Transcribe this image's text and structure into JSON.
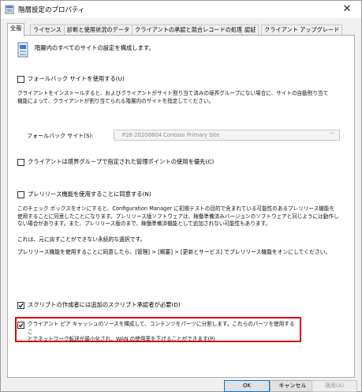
{
  "window": {
    "title": "階層設定のプロパティ",
    "close_glyph": "✕"
  },
  "tabs": [
    {
      "label": "全般",
      "active": true
    },
    {
      "label": "ライセンス"
    },
    {
      "label": "診断と使用状況のデータ"
    },
    {
      "label": "クライアントの承認と競合レコードの処理"
    },
    {
      "label": "認証"
    },
    {
      "label": "クライアント アップグレード"
    }
  ],
  "general": {
    "header_text": "階層内のすべてのサイトの設定を構成します。",
    "fallback": {
      "label": "フォールバック サイトを使用する(U)",
      "checked": false,
      "desc_line1": "クライアントをインストールすると、およびクライアントがサイト割り当て済みの境界グループにない場合に、サイトの自動割り当て",
      "desc_line2": "機能によって、クライアントが割り当てられる階層内のサイトを指定してください。",
      "site_label": "フォールバック サイト(S):",
      "site_value": "P26-20200604 Contoso Primary Site"
    },
    "prefer_mp": {
      "label": "クライアントは境界グループで指定された管理ポイントの使用を優先(C)",
      "checked": false
    },
    "prerelease": {
      "label": "プレリリース機能を使用することに同意する(N)",
      "checked": false,
      "desc_lines": [
        "このチェック ボックスをオンにすると、Configuration Manager に初期テストの目的で含まれている可能性のあるプレリリース機能を",
        "使用することに同意したことになります。プレリリース版ソフトウェアは、稼働準備済みバージョンのソフトウェアと同じようには動作し",
        "ない場合があります。また、プレリリース版のまで、稼働準備済機能として追加されない可能性もあります。"
      ],
      "note1": "これは、元に戻すことができない永続的な選択です。",
      "note2": "プレリリース機能を使用することに同意したら、[管理] > [概要] > [更新とサービス] でプレリリース機能をオンにしてください。"
    },
    "script_approver": {
      "label": "スクリプトの作成者には追加のスクリプト承認者が必要(D)",
      "checked": true
    },
    "peer_cache": {
      "line1": "クライアント ピア キャッシュのソースを構成して、コンテンツをパーツに分割します。これらのパーツを使用するこ",
      "line2": "とでネットワーク転送が最小化され、WAN の使用率を下げることができます(P)",
      "checked": true
    }
  },
  "buttons": {
    "ok": "OK",
    "cancel": "キャンセル",
    "apply": "適用(A)"
  },
  "colors": {
    "highlight": "#e00000",
    "accent": "#0078d7"
  }
}
